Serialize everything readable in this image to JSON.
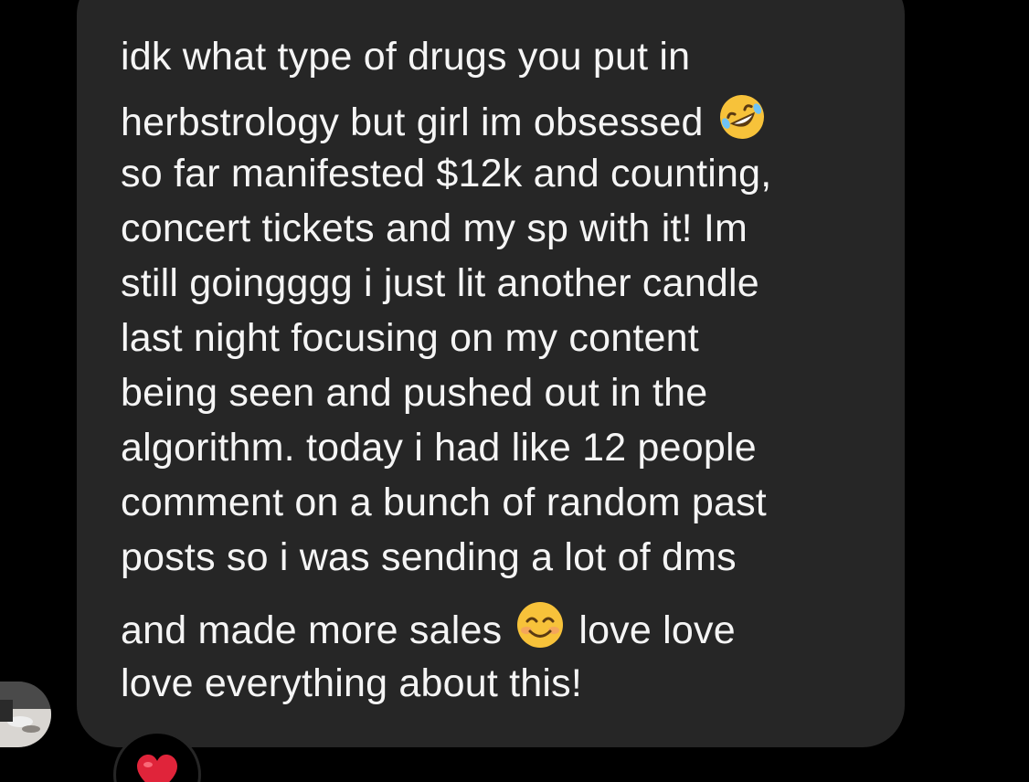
{
  "message": {
    "lines": [
      "idk what type of drugs you put in",
      "herbstrology but girl im obsessed",
      "so far manifested $12k and counting,",
      "concert tickets and my sp with it! Im",
      "still goingggg i just lit another candle",
      "last night focusing on my content",
      "being seen and pushed out in the",
      "algorithm. today i had like 12 people",
      "comment on a bunch of random past",
      "posts so i was sending a lot of dms",
      "and made more sales",
      "love love",
      "love everything about this!"
    ],
    "emojis": [
      "rolling-on-floor-laughing-emoji",
      "smiling-face-emoji"
    ]
  },
  "reaction": {
    "icon": "red-heart-icon"
  },
  "avatar": {
    "icon": "profile-photo"
  },
  "colors": {
    "background": "#000000",
    "bubble": "#262626",
    "text": "#f5f5f5",
    "heart": "#e0243a",
    "emoji_yellow": "#f7c23a"
  }
}
